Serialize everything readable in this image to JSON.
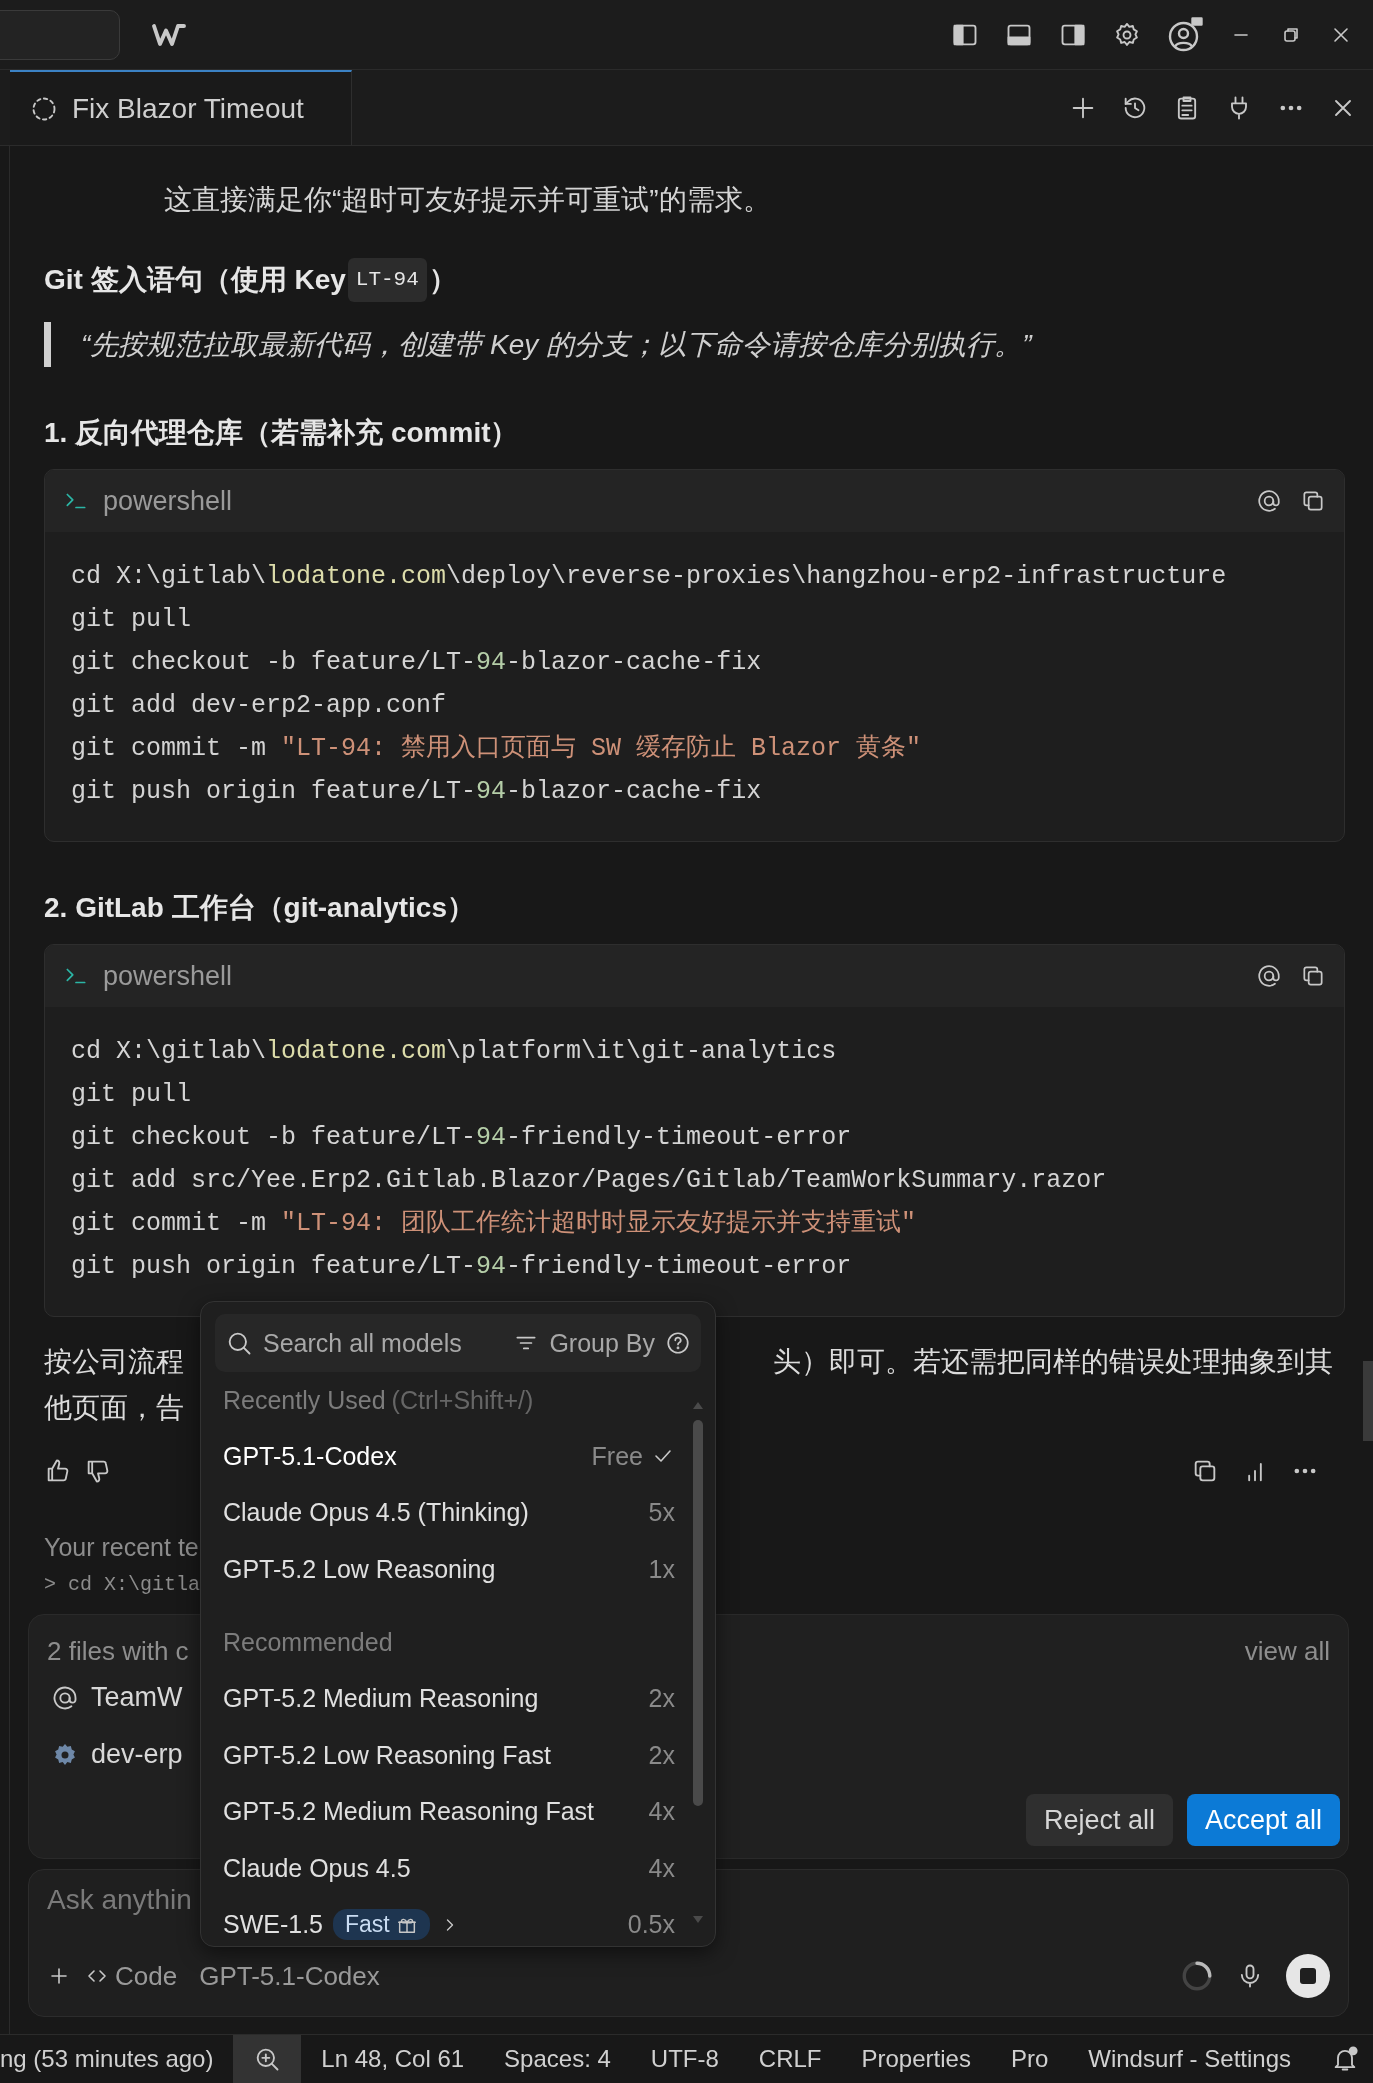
{
  "tab": {
    "title": "Fix Blazor Timeout"
  },
  "chat": {
    "lines": [
      "这直接满足你“超时可友好提示并可重试”的需求。"
    ],
    "heading": {
      "text": "Git 签入语句（使用 Key ",
      "code": "LT-94",
      "after": "）"
    },
    "quote": "“先按规范拉取最新代码，创建带 Key 的分支；以下命令请按仓库分别执行。”",
    "sections": [
      {
        "title": "1. 反向代理仓库（若需补充 commit）",
        "language": "powershell",
        "code": [
          [
            {
              "kind": "plain",
              "text": "cd X:\\gitlab\\"
            },
            {
              "kind": "link",
              "text": "lodatone.com"
            },
            {
              "kind": "plain",
              "text": "\\deploy\\reverse-proxies\\hangzhou-erp2-infrastructure"
            }
          ],
          [
            {
              "kind": "plain",
              "text": "git pull"
            }
          ],
          [
            {
              "kind": "plain",
              "text": "git checkout -b feature/LT-"
            },
            {
              "kind": "number",
              "text": "94"
            },
            {
              "kind": "plain",
              "text": "-blazor-cache-fix"
            }
          ],
          [
            {
              "kind": "plain",
              "text": "git add dev-erp2-app.conf"
            }
          ],
          [
            {
              "kind": "plain",
              "text": "git commit -m "
            },
            {
              "kind": "string",
              "text": "\"LT-94: 禁用入口页面与 SW 缓存防止 Blazor 黄条\""
            }
          ],
          [
            {
              "kind": "plain",
              "text": "git push origin feature/LT-"
            },
            {
              "kind": "number",
              "text": "94"
            },
            {
              "kind": "plain",
              "text": "-blazor-cache-fix"
            }
          ]
        ]
      },
      {
        "title": "2. GitLab 工作台（git-analytics）",
        "language": "powershell",
        "code": [
          [
            {
              "kind": "plain",
              "text": "cd X:\\gitlab\\"
            },
            {
              "kind": "link",
              "text": "lodatone.com"
            },
            {
              "kind": "plain",
              "text": "\\platform\\it\\git-analytics"
            }
          ],
          [
            {
              "kind": "plain",
              "text": "git pull"
            }
          ],
          [
            {
              "kind": "plain",
              "text": "git checkout -b feature/LT-"
            },
            {
              "kind": "number",
              "text": "94"
            },
            {
              "kind": "plain",
              "text": "-friendly-timeout-error"
            }
          ],
          [
            {
              "kind": "plain",
              "text": "git add src/Yee.Erp2.Gitlab.Blazor/Pages/Gitlab/TeamWorkSummary.razor"
            }
          ],
          [
            {
              "kind": "plain",
              "text": "git commit -m "
            },
            {
              "kind": "string",
              "text": "\"LT-94: 团队工作统计超时时显示友好提示并支持重试\""
            }
          ],
          [
            {
              "kind": "plain",
              "text": "git push origin feature/LT-"
            },
            {
              "kind": "number",
              "text": "94"
            },
            {
              "kind": "plain",
              "text": "-friendly-timeout-error"
            }
          ]
        ]
      }
    ],
    "paragraph": {
      "left": [
        "按公司流程",
        "他页面，告"
      ],
      "right": "头）即可。若还需把同样的错误处理抽象到其"
    },
    "recent": {
      "label": "Your recent te",
      "command": "> cd X:\\gitla"
    }
  },
  "changes": {
    "title": "2 files with c",
    "view_all": "view all",
    "files": [
      {
        "name": "TeamW",
        "kind": "mention"
      },
      {
        "name": "dev-erp",
        "kind": "config"
      }
    ],
    "buttons": [
      {
        "label": "Reject all",
        "kind": "secondary"
      },
      {
        "label": "Accept all",
        "kind": "primary"
      }
    ]
  },
  "input": {
    "placeholder": "Ask anythin",
    "mode": "Code",
    "model": "GPT-5.1-Codex"
  },
  "model_menu": {
    "search_placeholder": "Search all models",
    "group_by": "Group By",
    "groups": [
      {
        "title": "Recently Used",
        "hint": "(Ctrl+Shift+/)",
        "items": [
          {
            "name": "GPT-5.1-Codex",
            "cost": "Free",
            "selected": true
          },
          {
            "name": "Claude Opus 4.5 (Thinking)",
            "cost": "5x",
            "selected": false
          },
          {
            "name": "GPT-5.2 Low Reasoning",
            "cost": "1x",
            "selected": false
          }
        ]
      },
      {
        "title": "Recommended",
        "items": [
          {
            "name": "GPT-5.2 Medium Reasoning",
            "cost": "2x",
            "selected": false
          },
          {
            "name": "GPT-5.2 Low Reasoning Fast",
            "cost": "2x",
            "selected": false
          },
          {
            "name": "GPT-5.2 Medium Reasoning Fast",
            "cost": "4x",
            "selected": false
          },
          {
            "name": "Claude Opus 4.5",
            "cost": "4x",
            "selected": false
          },
          {
            "name": "SWE-1.5",
            "badge": "Fast",
            "cost": "0.5x",
            "selected": false
          }
        ]
      }
    ]
  },
  "status_bar": {
    "left": "ng (53 minutes ago)",
    "items": [
      "Ln 48, Col 61",
      "Spaces: 4",
      "UTF-8",
      "CRLF",
      "Properties",
      "Pro",
      "Windsurf - Settings"
    ]
  }
}
